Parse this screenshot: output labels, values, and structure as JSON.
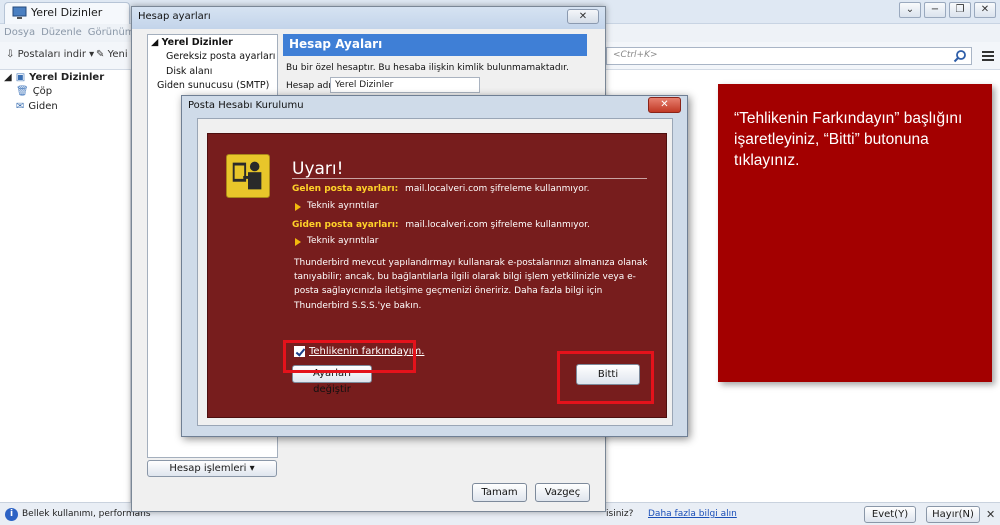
{
  "app": {
    "tab_title": "Yerel Dizinler",
    "win_buttons": [
      "⌄",
      "−",
      "❐",
      "✕"
    ]
  },
  "menubar": [
    "Dosya",
    "Düzenle",
    "Görünüm",
    "Gi"
  ],
  "toolbar": {
    "get_mail": "Postaları indir",
    "write": "Yeni i",
    "search_placeholder": "<Ctrl+K>"
  },
  "folders": {
    "root": "Yerel Dizinler",
    "items": [
      "Çöp",
      "Giden"
    ]
  },
  "statusbar": {
    "left_text": "Bellek kullanımı, performans",
    "right_text": "isiniz?",
    "link": "Daha fazla bilgi alın",
    "yes": "Evet(Y)",
    "no": "Hayır(N)",
    "close": "✕"
  },
  "settings_dialog": {
    "title": "Hesap ayarları",
    "close": "✕",
    "tree": [
      "Yerel Dizinler",
      "Gereksiz posta ayarları",
      "Disk alanı",
      "Giden sunucusu (SMTP)"
    ],
    "header": "Hesap Ayaları",
    "desc": "Bu bir özel hesaptır. Bu hesaba ilişkin kimlik bulunmamaktadır.",
    "account_name_label": "Hesap adı:",
    "account_name_value": "Yerel Dizinler",
    "account_actions": "Hesap işlemleri",
    "ok": "Tamam",
    "cancel": "Vazgeç"
  },
  "setup_dialog": {
    "title": "Posta Hesabı Kurulumu",
    "close": "✕",
    "warning_title": "Uyarı!",
    "incoming_label": "Gelen posta ayarları:",
    "incoming_text": "mail.localveri.com şifreleme kullanmıyor.",
    "details_1": "Teknik ayrıntılar",
    "outgoing_label": "Giden posta ayarları:",
    "outgoing_text": "mail.localveri.com şifreleme kullanmıyor.",
    "details_2": "Teknik ayrıntılar",
    "body": "Thunderbird mevcut yapılandırmayı kullanarak e-postalarınızı almanıza olanak tanıyabilir; ancak, bu bağlantılarla ilgili olarak bilgi işlem yetkilinizle veya e-posta sağlayıcınızla iletişime geçmenizi öneririz. Daha fazla bilgi için Thunderbird S.S.S.'ye bakın.",
    "checkbox_label": "Tehlikenin farkındayım.",
    "change_settings": "Ayarları değiştir",
    "done": "Bitti"
  },
  "callout": {
    "text": "“Tehlikenin Farkındayın” başlığını işaretleyiniz, “Bitti” butonuna tıklayınız."
  },
  "colors": {
    "warning_bg": "#771d1d",
    "callout_bg": "#a30000",
    "highlight": "#e4121b",
    "header_blue": "#3f7fd6"
  }
}
